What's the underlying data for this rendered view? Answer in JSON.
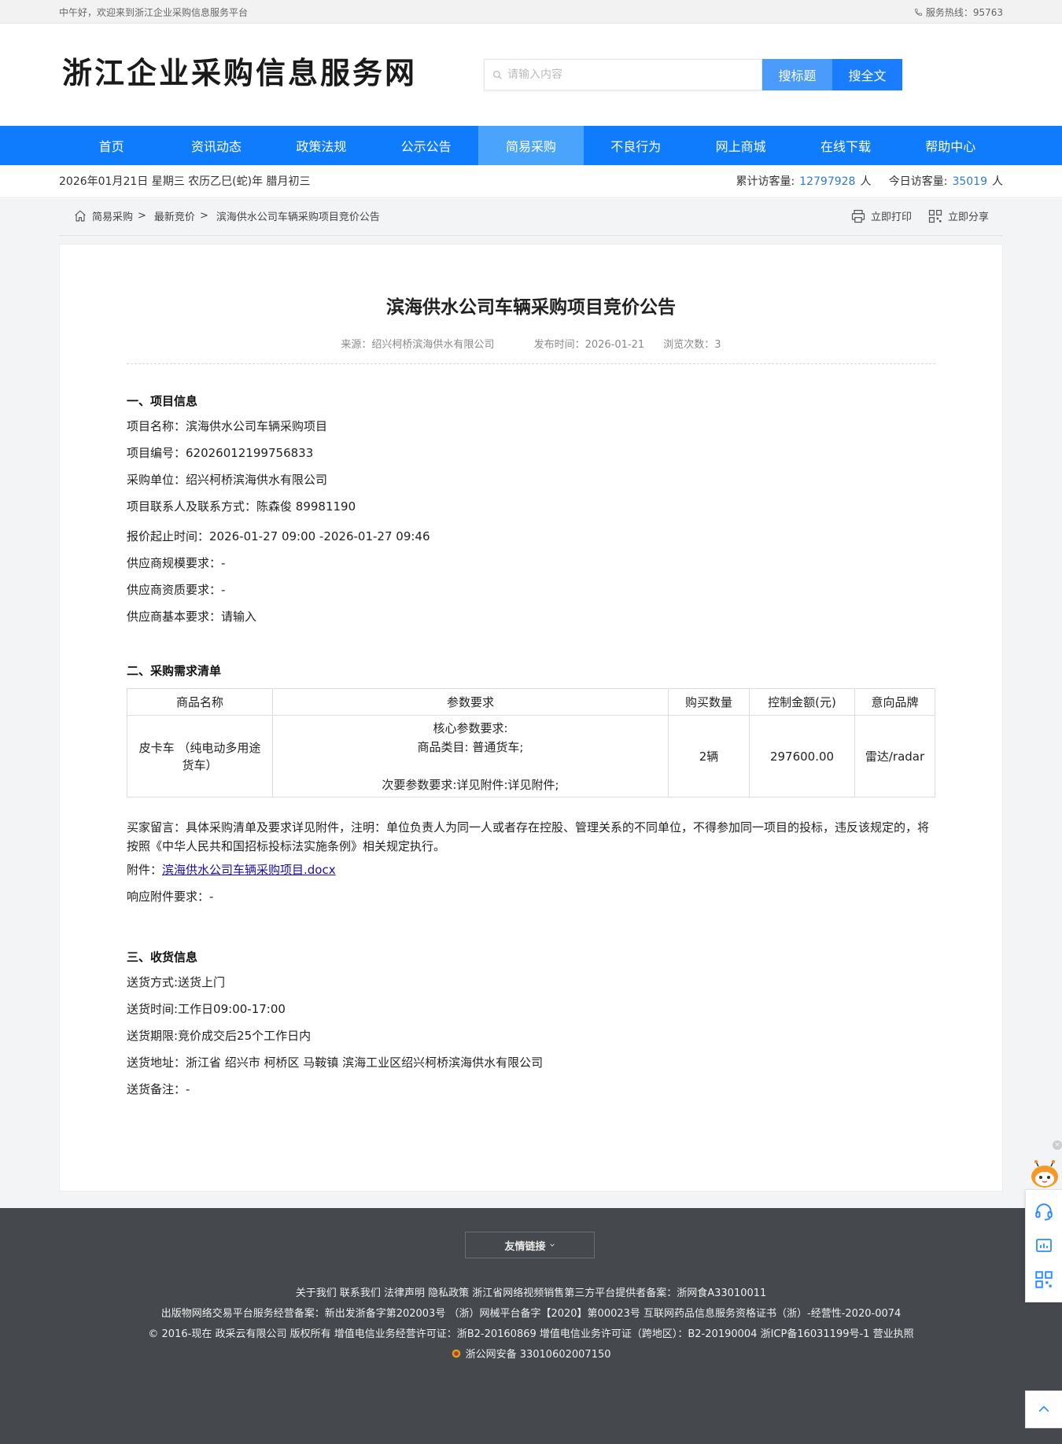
{
  "topbar": {
    "welcome": "中午好，欢迎来到浙江企业采购信息服务平台",
    "hotline": "服务热线：95763"
  },
  "header": {
    "site_title": "浙江企业采购信息服务网",
    "search_placeholder": "请输入内容",
    "search_title_btn": "搜标题",
    "search_full_btn": "搜全文"
  },
  "nav": {
    "items": [
      "首页",
      "资讯动态",
      "政策法规",
      "公示公告",
      "简易采购",
      "不良行为",
      "网上商城",
      "在线下载",
      "帮助中心"
    ],
    "active_index": 4
  },
  "datebar": {
    "date": "2026年01月21日 星期三 农历乙巳(蛇)年 腊月初三",
    "total_label": "累计访客量:",
    "total_value": "12797928",
    "today_label": "今日访客量:",
    "today_value": "35019",
    "unit": "人"
  },
  "breadcrumb": {
    "items": [
      "简易采购",
      "最新竞价",
      "滨海供水公司车辆采购项目竞价公告"
    ],
    "separator": ">",
    "print": "立即打印",
    "share": "立即分享"
  },
  "article": {
    "title": "滨海供水公司车辆采购项目竞价公告",
    "source": "来源：绍兴柯桥滨海供水有限公司",
    "publish": "发布时间：2026-01-21",
    "views": "浏览次数：3",
    "sec1_title": "一、项目信息",
    "sec1_lines": [
      "项目名称：滨海供水公司车辆采购项目",
      "项目编号：62026012199756833",
      "采购单位：绍兴柯桥滨海供水有限公司",
      "项目联系人及联系方式：陈森俊 89981190",
      "报价起止时间：2026-01-27 09:00 -2026-01-27 09:46",
      "供应商规模要求：-",
      "供应商资质要求：-",
      "供应商基本要求：请输入"
    ],
    "sec2_title": "二、采购需求清单",
    "table": {
      "headers": [
        "商品名称",
        "参数要求",
        "购买数量",
        "控制金额(元)",
        "意向品牌"
      ],
      "row": {
        "name": "皮卡车 （纯电动多用途货车）",
        "param1": "核心参数要求:",
        "param2": "商品类目: 普通货车;",
        "param3": "次要参数要求:详见附件:详见附件;",
        "qty": "2辆",
        "amount": "297600.00",
        "brand": "雷达/radar"
      }
    },
    "buyer_msg": "买家留言：具体采购清单及要求详见附件，注明：单位负责人为同一人或者存在控股、管理关系的不同单位，不得参加同一项目的投标，违反该规定的，将按照《中华人民共和国招标投标法实施条例》相关规定执行。",
    "attach_label": "附件：",
    "attach_link": "滨海供水公司车辆采购项目.docx",
    "response_req": "响应附件要求：-",
    "sec3_title": "三、收货信息",
    "sec3_lines": [
      "送货方式:送货上门",
      "送货时间:工作日09:00-17:00",
      "送货期限:竞价成交后25个工作日内",
      "送货地址：浙江省 绍兴市 柯桥区 马鞍镇 滨海工业区绍兴柯桥滨海供水有限公司",
      "送货备注：-"
    ]
  },
  "footer": {
    "friend_links": "友情链接",
    "line1": "关于我们 联系我们 法律声明 隐私政策 浙江省网络视频销售第三方平台提供者备案：浙网食A33010011",
    "line2": "出版物网络交易平台服务经营备案：新出发浙备字第202003号 （浙）网械平台备字【2020】第00023号 互联网药品信息服务资格证书（浙）-经营性-2020-0074",
    "line3": "© 2016-现在 政采云有限公司 版权所有 增值电信业务经营许可证：浙B2-20160869 增值电信业务许可证（跨地区）：B2-20190004 浙ICP备16031199号-1 营业执照",
    "line4": "浙公网安备 33010602007150"
  },
  "colors": {
    "nav_bg": "#0f7bfd",
    "nav_active": "#4aa4fc",
    "footer_bg": "#45484d",
    "accent_number": "#2d7ccb"
  }
}
